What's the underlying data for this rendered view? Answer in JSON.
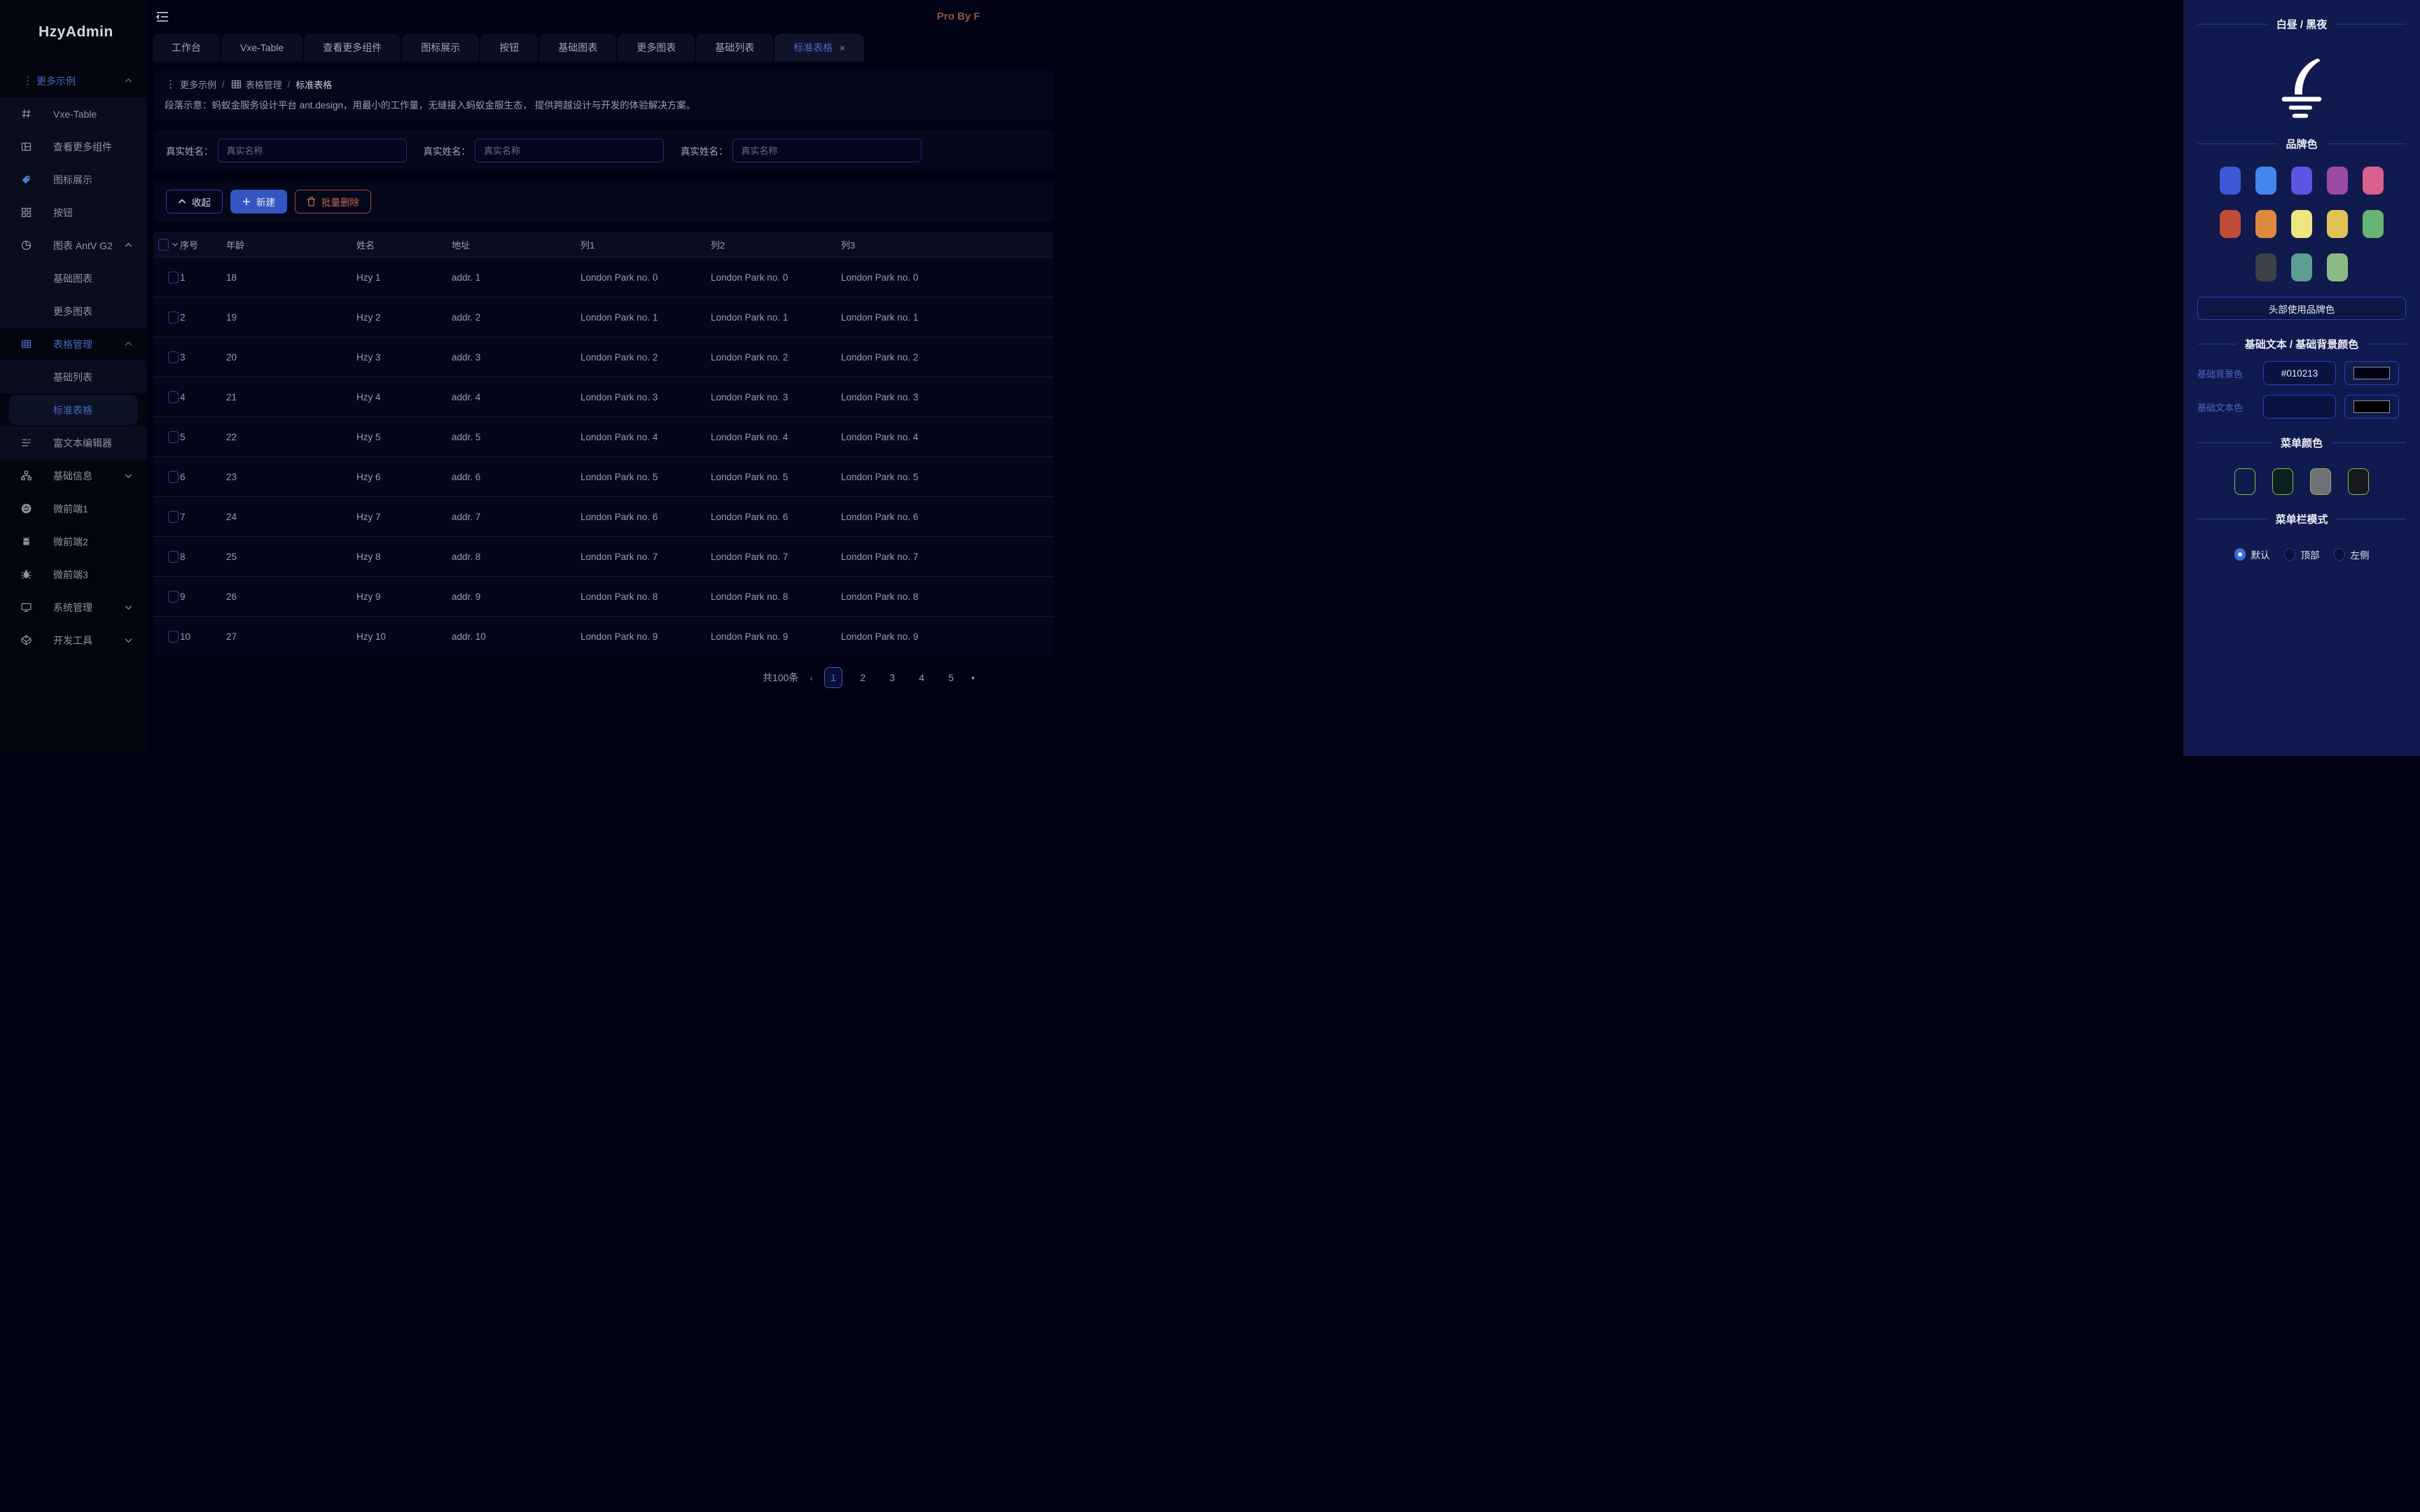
{
  "app": {
    "logo": "HzyAdmin",
    "watermark": "Pro By F"
  },
  "tabs": [
    {
      "label": "工作台",
      "active": false,
      "closable": false
    },
    {
      "label": "Vxe-Table",
      "active": false,
      "closable": false
    },
    {
      "label": "查看更多组件",
      "active": false,
      "closable": false
    },
    {
      "label": "图标展示",
      "active": false,
      "closable": false
    },
    {
      "label": "按钮",
      "active": false,
      "closable": false
    },
    {
      "label": "基础图表",
      "active": false,
      "closable": false
    },
    {
      "label": "更多图表",
      "active": false,
      "closable": false
    },
    {
      "label": "基础列表",
      "active": false,
      "closable": false
    },
    {
      "label": "标准表格",
      "active": true,
      "closable": true,
      "close_glyph": "×"
    }
  ],
  "sidebar": {
    "items": [
      {
        "type": "grp",
        "zone": "dark",
        "icon": "dots-vertical-icon",
        "label": "更多示例",
        "chevron": "up"
      },
      {
        "type": "item",
        "zone": "light",
        "icon": "vxe-table-icon",
        "label": "Vxe-Table"
      },
      {
        "type": "item",
        "zone": "light",
        "icon": "layout-icon",
        "label": "查看更多组件"
      },
      {
        "type": "item",
        "zone": "light",
        "icon": "tag-icon",
        "label": "图标展示",
        "icon_color": "#4d7fd0"
      },
      {
        "type": "item",
        "zone": "light",
        "icon": "appstore-icon",
        "label": "按钮"
      },
      {
        "type": "item",
        "zone": "light",
        "icon": "pie-chart-icon",
        "label": "图表 AntV G2",
        "chevron": "up"
      },
      {
        "type": "sub",
        "zone": "light",
        "label": "基础图表"
      },
      {
        "type": "sub",
        "zone": "light",
        "label": "更多图表"
      },
      {
        "type": "item blue",
        "zone": "dark",
        "icon": "table-icon",
        "label": "表格管理",
        "chevron": "up"
      },
      {
        "type": "sub",
        "zone": "light",
        "label": "基础列表"
      },
      {
        "type": "sub active",
        "zone": "light",
        "label": "标准表格"
      },
      {
        "type": "item",
        "zone": "light",
        "icon": "rich-text-icon",
        "label": "富文本编辑器"
      },
      {
        "type": "item",
        "zone": "dark",
        "icon": "sitemap-icon",
        "label": "基础信息",
        "chevron": "down"
      },
      {
        "type": "item",
        "zone": "dark",
        "icon": "alipay-icon",
        "label": "微前端1"
      },
      {
        "type": "item",
        "zone": "dark",
        "icon": "android-icon",
        "label": "微前端2"
      },
      {
        "type": "item",
        "zone": "dark",
        "icon": "bug-icon",
        "label": "微前端3"
      },
      {
        "type": "item",
        "zone": "dark",
        "icon": "monitor-icon",
        "label": "系统管理",
        "chevron": "down"
      },
      {
        "type": "item",
        "zone": "dark",
        "icon": "codepen-icon",
        "label": "开发工具",
        "chevron": "down"
      }
    ]
  },
  "breadcrumb": {
    "separator": "/",
    "items": [
      {
        "label": "更多示例",
        "icon": "dots-vertical-icon"
      },
      {
        "label": "表格管理",
        "icon": "table-icon"
      },
      {
        "label": "标准表格"
      }
    ]
  },
  "page": {
    "intro": "段落示意：蚂蚁金服务设计平台 ant.design，用最小的工作量，无缝接入蚂蚁金服生态， 提供跨越设计与开发的体验解决方案。"
  },
  "filters": [
    {
      "label": "真实姓名：",
      "placeholder": "真实名称",
      "value": ""
    },
    {
      "label": "真实姓名：",
      "placeholder": "真实名称",
      "value": ""
    },
    {
      "label": "真实姓名：",
      "placeholder": "真实名称",
      "value": ""
    }
  ],
  "toolbar": {
    "collapse_label": "收起",
    "create_label": "新建",
    "batch_delete_label": "批量删除"
  },
  "table": {
    "columns": [
      "序号",
      "年龄",
      "姓名",
      "地址",
      "列1",
      "列2",
      "列3"
    ],
    "rows": [
      {
        "no": "1",
        "age": "18",
        "name": "Hzy 1",
        "addr": "addr. 1",
        "c1": "London Park no. 0",
        "c2": "London Park no. 0",
        "c3": "London Park no. 0"
      },
      {
        "no": "2",
        "age": "19",
        "name": "Hzy 2",
        "addr": "addr. 2",
        "c1": "London Park no. 1",
        "c2": "London Park no. 1",
        "c3": "London Park no. 1"
      },
      {
        "no": "3",
        "age": "20",
        "name": "Hzy 3",
        "addr": "addr. 3",
        "c1": "London Park no. 2",
        "c2": "London Park no. 2",
        "c3": "London Park no. 2"
      },
      {
        "no": "4",
        "age": "21",
        "name": "Hzy 4",
        "addr": "addr. 4",
        "c1": "London Park no. 3",
        "c2": "London Park no. 3",
        "c3": "London Park no. 3"
      },
      {
        "no": "5",
        "age": "22",
        "name": "Hzy 5",
        "addr": "addr. 5",
        "c1": "London Park no. 4",
        "c2": "London Park no. 4",
        "c3": "London Park no. 4"
      },
      {
        "no": "6",
        "age": "23",
        "name": "Hzy 6",
        "addr": "addr. 6",
        "c1": "London Park no. 5",
        "c2": "London Park no. 5",
        "c3": "London Park no. 5"
      },
      {
        "no": "7",
        "age": "24",
        "name": "Hzy 7",
        "addr": "addr. 7",
        "c1": "London Park no. 6",
        "c2": "London Park no. 6",
        "c3": "London Park no. 6"
      },
      {
        "no": "8",
        "age": "25",
        "name": "Hzy 8",
        "addr": "addr. 8",
        "c1": "London Park no. 7",
        "c2": "London Park no. 7",
        "c3": "London Park no. 7"
      },
      {
        "no": "9",
        "age": "26",
        "name": "Hzy 9",
        "addr": "addr. 9",
        "c1": "London Park no. 8",
        "c2": "London Park no. 8",
        "c3": "London Park no. 8"
      },
      {
        "no": "10",
        "age": "27",
        "name": "Hzy 10",
        "addr": "addr. 10",
        "c1": "London Park no. 9",
        "c2": "London Park no. 9",
        "c3": "London Park no. 9"
      }
    ]
  },
  "pagination": {
    "total_label": "共100条",
    "prev_glyph": "‹",
    "pages": [
      "1",
      "2",
      "3",
      "4",
      "5"
    ],
    "active_page": "1",
    "more_glyph": "•"
  },
  "theme_panel": {
    "day_night_title": "白昼 / 黑夜",
    "brand_title": "品牌色",
    "brand_rows": [
      [
        "#3d58d8",
        "#4285ec",
        "#5b55e3",
        "#9b4ba4",
        "#d9608f"
      ],
      [
        "#c24b3a",
        "#dd8a40",
        "#ece87f",
        "#e2c357",
        "#67b575"
      ],
      [
        "#3c4147",
        "#5d9d92",
        "#8cbb85"
      ]
    ],
    "header_brand_button": "头部使用品牌色",
    "base_title": "基础文本 / 基础背景颜色",
    "base_bg": {
      "label": "基础背景色",
      "value": "#010213",
      "well": "#010213"
    },
    "base_text": {
      "label": "基础文本色",
      "value": "",
      "well": "#000000"
    },
    "menu_color_title": "菜单颜色",
    "menu_colors": [
      "transparent",
      "#0d201f",
      "#6e7276",
      "#16191d"
    ],
    "menu_swatch_border": "#8ab94e",
    "mode_title": "菜单栏模式",
    "mode_options": [
      {
        "label": "默认",
        "selected": true
      },
      {
        "label": "顶部",
        "selected": false
      },
      {
        "label": "左侧",
        "selected": false
      }
    ]
  }
}
